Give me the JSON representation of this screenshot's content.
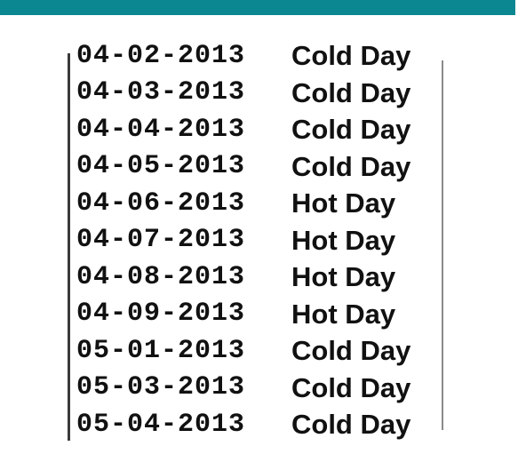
{
  "header": {
    "bar_color": "#0a8791"
  },
  "list": {
    "items": [
      {
        "date": "04-02-2013",
        "label": "Cold Day"
      },
      {
        "date": "04-03-2013",
        "label": "Cold Day"
      },
      {
        "date": "04-04-2013",
        "label": "Cold Day"
      },
      {
        "date": "04-05-2013",
        "label": "Cold Day"
      },
      {
        "date": "04-06-2013",
        "label": "Hot Day"
      },
      {
        "date": "04-07-2013",
        "label": "Hot Day"
      },
      {
        "date": "04-08-2013",
        "label": "Hot Day"
      },
      {
        "date": "04-09-2013",
        "label": "Hot Day"
      },
      {
        "date": "05-01-2013",
        "label": "Cold Day"
      },
      {
        "date": "05-03-2013",
        "label": "Cold Day"
      },
      {
        "date": "05-04-2013",
        "label": "Cold Day"
      }
    ]
  }
}
